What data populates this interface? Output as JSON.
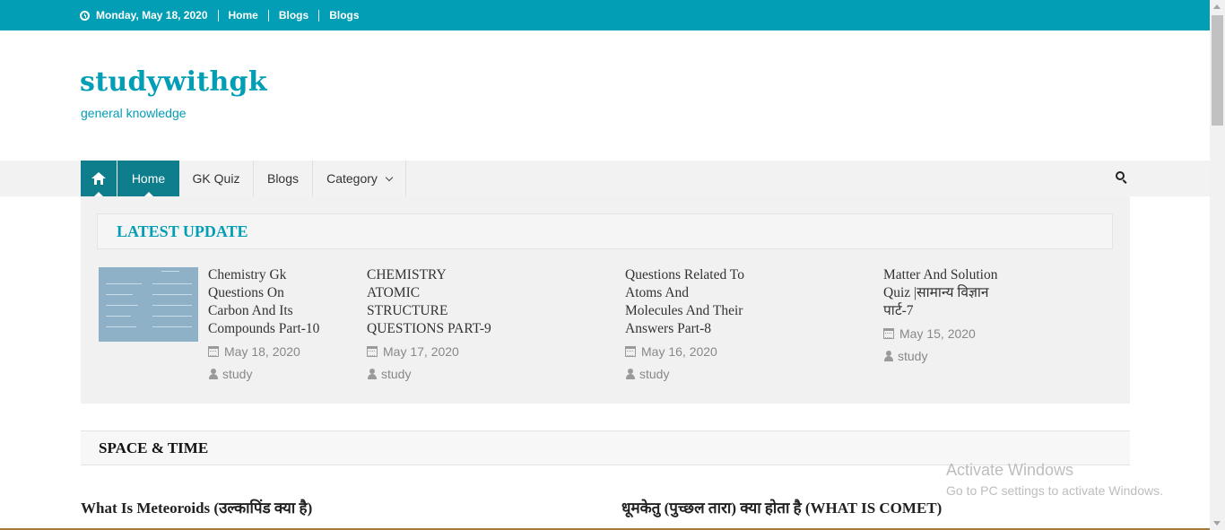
{
  "topbar": {
    "date": "Monday, May 18, 2020",
    "links": [
      "Home",
      "Blogs",
      "Blogs"
    ]
  },
  "site": {
    "title": "studywithgk",
    "tagline": "general knowledge"
  },
  "nav": {
    "items": [
      "Home",
      "GK Quiz",
      "Blogs",
      "Category"
    ],
    "active": "Home"
  },
  "latest": {
    "heading": "LATEST UPDATE",
    "posts": [
      {
        "title_lines": [
          "Chemistry Gk",
          "Questions On",
          "Carbon And Its",
          "Compounds Part-10"
        ],
        "date": "May 18, 2020",
        "author": "study"
      },
      {
        "title_lines": [
          "CHEMISTRY",
          "ATOMIC",
          "STRUCTURE",
          "QUESTIONS PART-9"
        ],
        "date": "May 17, 2020",
        "author": "study"
      },
      {
        "title_lines": [
          "Questions Related To",
          "Atoms And",
          "Molecules And Their",
          "Answers Part-8"
        ],
        "date": "May 16, 2020",
        "author": "study"
      },
      {
        "title_lines": [
          "Matter And Solution",
          "Quiz |सामान्य विज्ञान",
          "पार्ट-7"
        ],
        "date": "May 15, 2020",
        "author": "study"
      }
    ]
  },
  "section": {
    "heading": "SPACE & TIME",
    "articles": [
      "What Is Meteoroids (उल्कापिंड क्या है)",
      "धूमकेतु (पुच्छल तारा) क्या होता है (WHAT IS COMET)"
    ]
  },
  "watermark": {
    "line1": "Activate Windows",
    "line2": "Go to PC settings to activate Windows."
  },
  "colors": {
    "accent": "#029eb5",
    "nav_active": "#0e7d8c"
  },
  "icons": [
    "clock-icon",
    "home-icon",
    "chevron-down-icon",
    "search-icon",
    "calendar-icon",
    "user-icon"
  ]
}
